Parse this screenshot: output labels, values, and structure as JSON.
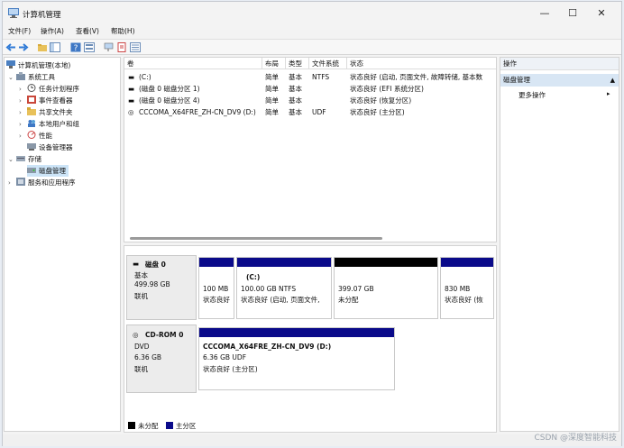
{
  "window": {
    "title": "计算机管理",
    "minimize_glyph": "—",
    "maximize_glyph": "☐",
    "close_glyph": "✕"
  },
  "menu": [
    "文件(F)",
    "操作(A)",
    "查看(V)",
    "帮助(H)"
  ],
  "tree": {
    "root": "计算机管理(本地)",
    "system_tools": "系统工具",
    "task_scheduler": "任务计划程序",
    "event_viewer": "事件查看器",
    "shared_folders": "共享文件夹",
    "local_users": "本地用户和组",
    "performance": "性能",
    "device_manager": "设备管理器",
    "storage": "存储",
    "disk_management": "磁盘管理",
    "services_apps": "服务和应用程序"
  },
  "volumes": {
    "headers": [
      "卷",
      "布局",
      "类型",
      "文件系统",
      "状态"
    ],
    "rows": [
      [
        "(C:)",
        "简单",
        "基本",
        "NTFS",
        "状态良好 (启动, 页面文件, 故障转储, 基本数"
      ],
      [
        "(磁盘 0 磁盘分区 1)",
        "简单",
        "基本",
        "",
        "状态良好 (EFI 系统分区)"
      ],
      [
        "(磁盘 0 磁盘分区 4)",
        "简单",
        "基本",
        "",
        "状态良好 (恢复分区)"
      ],
      [
        "CCCOMA_X64FRE_ZH-CN_DV9 (D:)",
        "简单",
        "基本",
        "UDF",
        "状态良好 (主分区)"
      ]
    ]
  },
  "disk0": {
    "name": "磁盘 0",
    "type": "基本",
    "size": "499.98 GB",
    "status": "联机",
    "partitions": [
      {
        "label": "",
        "line1": "100 MB",
        "line2": "状态良好"
      },
      {
        "label": "(C:)",
        "line1": "100.00 GB NTFS",
        "line2": "状态良好 (启动, 页面文件,"
      },
      {
        "label": "",
        "line1": "399.07 GB",
        "line2": "未分配"
      },
      {
        "label": "",
        "line1": "830 MB",
        "line2": "状态良好 (恢"
      }
    ]
  },
  "cdrom0": {
    "name": "CD-ROM 0",
    "type": "DVD",
    "size": "6.36 GB",
    "status": "联机",
    "partition": {
      "label": "CCCOMA_X64FRE_ZH-CN_DV9 (D:)",
      "line1": "6.36 GB UDF",
      "line2": "状态良好 (主分区)"
    }
  },
  "legend": {
    "unallocated": "未分配",
    "primary": "主分区"
  },
  "actions": {
    "header": "操作",
    "section": "磁盘管理",
    "more": "更多操作"
  },
  "watermark": "CSDN @深度智能科技",
  "colors": {
    "primary_partition": "#0a0a8a",
    "unallocated": "#000000",
    "selection": "#cce4f7"
  }
}
